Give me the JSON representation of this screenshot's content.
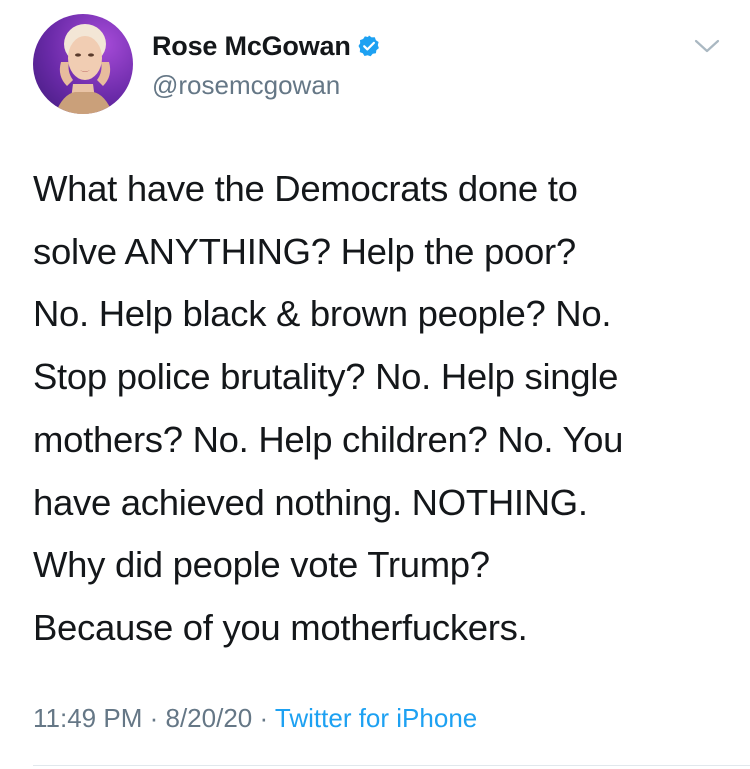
{
  "user": {
    "display_name": "Rose McGowan",
    "handle": "@rosemcgowan",
    "verified": true
  },
  "tweet": {
    "lines": [
      "What have the Democrats done to",
      "solve ANYTHING? Help the poor?",
      "No. Help black & brown people? No.",
      "Stop police brutality? No. Help single",
      "mothers? No. Help children? No. You",
      "have achieved nothing. NOTHING.",
      "Why did people vote Trump?",
      "Because of you motherfuckers."
    ]
  },
  "meta": {
    "time": "11:49 PM",
    "separator": "·",
    "date": "8/20/20",
    "source": "Twitter for iPhone"
  },
  "icons": {
    "verified": "verified-badge-icon",
    "menu": "chevron-down-icon"
  },
  "colors": {
    "verified_blue": "#1da1f2",
    "link_blue": "#1da1f2",
    "secondary_gray": "#657786",
    "text": "#14171a"
  }
}
